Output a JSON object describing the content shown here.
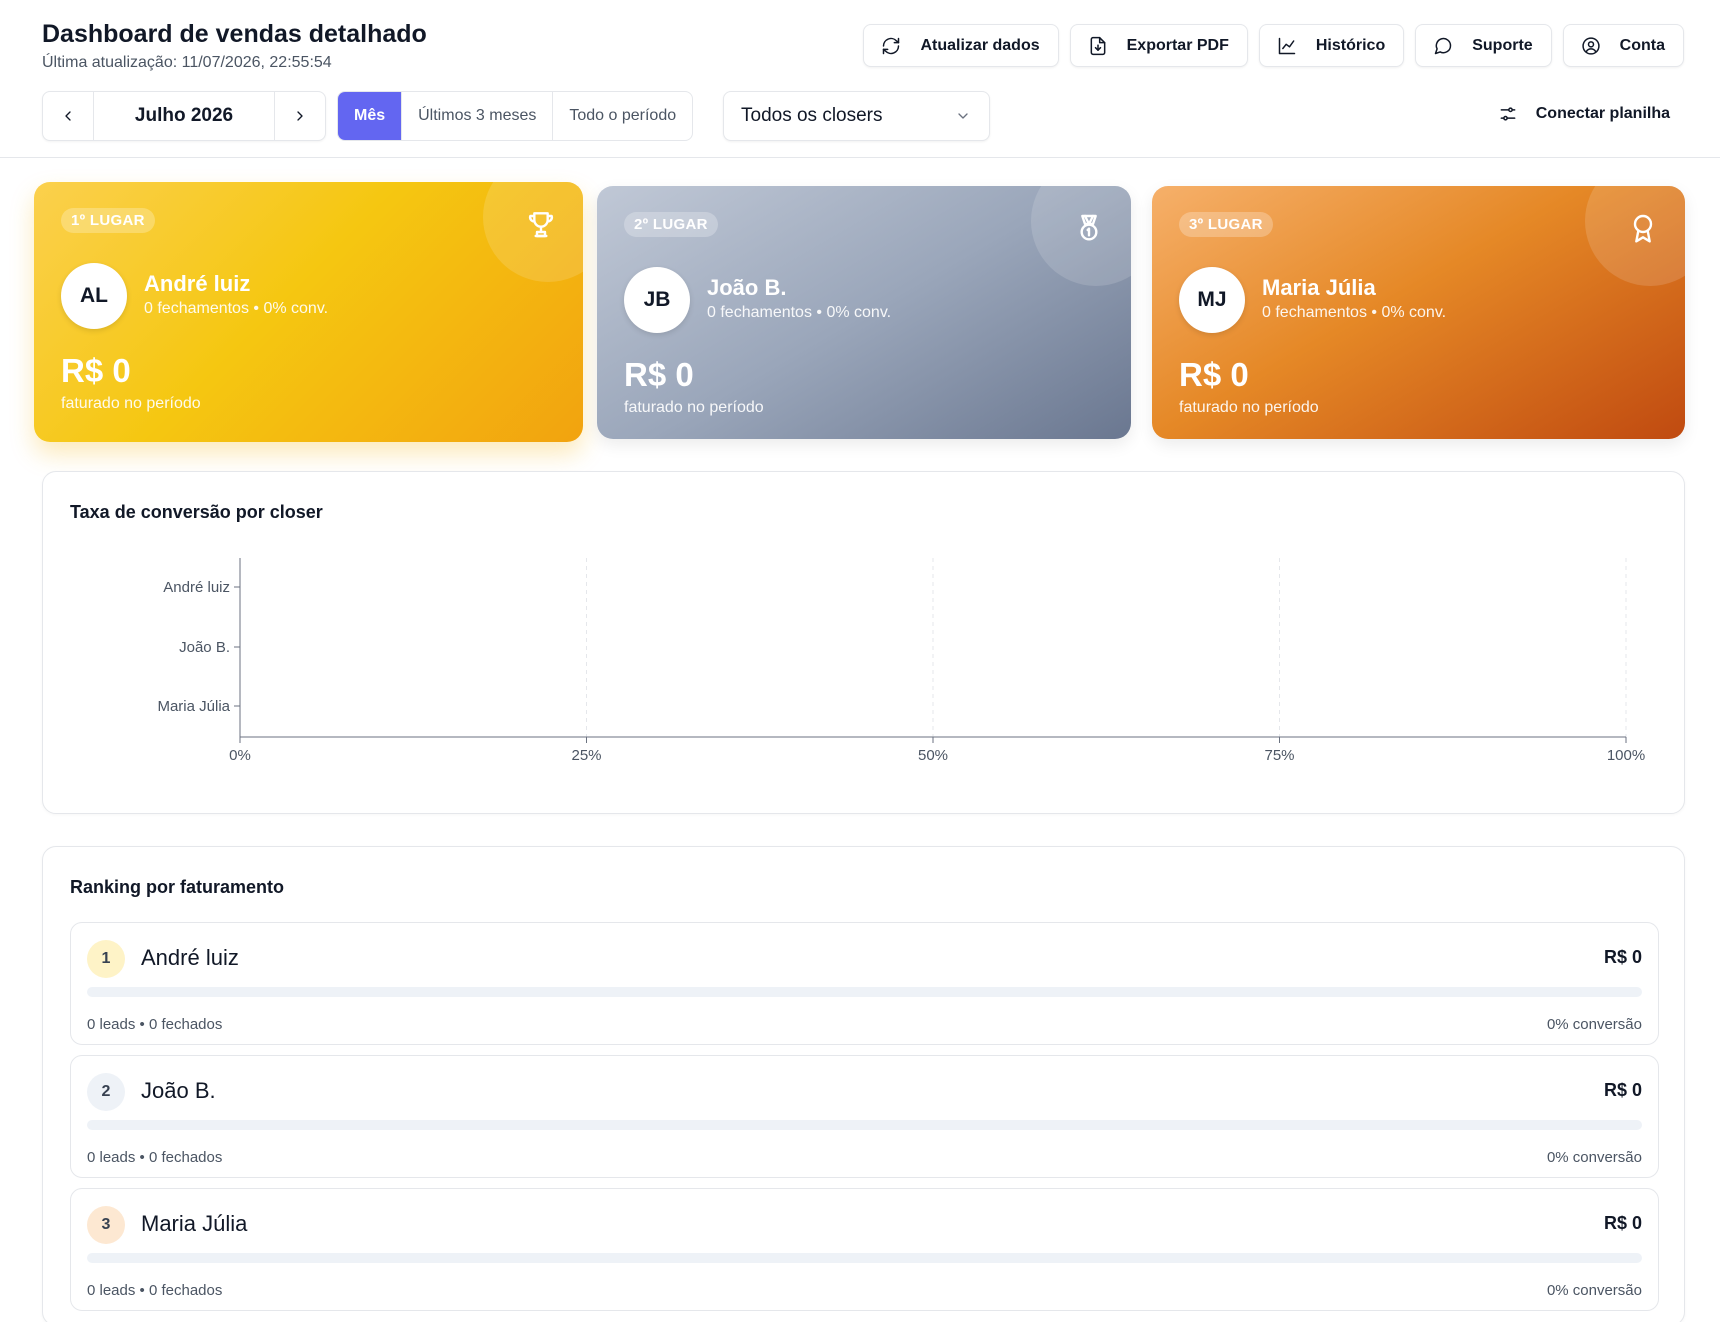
{
  "header": {
    "title": "Dashboard de vendas detalhado",
    "updated": "Última atualização: 11/07/2026, 22:55:54",
    "actions": [
      {
        "label": "Atualizar dados",
        "icon": "refresh-icon"
      },
      {
        "label": "Exportar PDF",
        "icon": "file-download-icon"
      },
      {
        "label": "Histórico",
        "icon": "line-chart-icon"
      },
      {
        "label": "Suporte",
        "icon": "message-circle-icon"
      },
      {
        "label": "Conta",
        "icon": "user-circle-icon"
      }
    ]
  },
  "filters": {
    "month": "Julho 2026",
    "period_tabs": [
      "Mês",
      "Últimos 3 meses",
      "Todo o período"
    ],
    "active_period": "Mês",
    "closer_select": "Todos os closers",
    "connect_label": "Conectar planilha"
  },
  "podium": [
    {
      "place": "1º LUGAR",
      "initials": "AL",
      "name": "André luiz",
      "meta": "0 fechamentos • 0% conv.",
      "amount": "R$ 0",
      "sub": "faturado no período",
      "icon": "trophy-icon"
    },
    {
      "place": "2º LUGAR",
      "initials": "JB",
      "name": "João B.",
      "meta": "0 fechamentos • 0% conv.",
      "amount": "R$ 0",
      "sub": "faturado no período",
      "icon": "medal-icon"
    },
    {
      "place": "3º LUGAR",
      "initials": "MJ",
      "name": "Maria Júlia",
      "meta": "0 fechamentos • 0% conv.",
      "amount": "R$ 0",
      "sub": "faturado no período",
      "icon": "award-icon"
    }
  ],
  "chart_panel": {
    "title": "Taxa de conversão por closer"
  },
  "chart_data": {
    "type": "bar",
    "orientation": "horizontal",
    "categories": [
      "André luiz",
      "João B.",
      "Maria Júlia"
    ],
    "values": [
      0,
      0,
      0
    ],
    "xlim": [
      0,
      100
    ],
    "x_ticks": [
      "0%",
      "25%",
      "50%",
      "75%",
      "100%"
    ],
    "grid": true
  },
  "ranking": {
    "title": "Ranking por faturamento",
    "rows": [
      {
        "rank": "1",
        "name": "André luiz",
        "amount": "R$ 0",
        "stats": "0 leads • 0 fechados",
        "conversion": "0% conversão",
        "progress": 0,
        "badge_color": "#fef3c7"
      },
      {
        "rank": "2",
        "name": "João B.",
        "amount": "R$ 0",
        "stats": "0 leads • 0 fechados",
        "conversion": "0% conversão",
        "progress": 0,
        "badge_color": "#eef2f7"
      },
      {
        "rank": "3",
        "name": "Maria Júlia",
        "amount": "R$ 0",
        "stats": "0 leads • 0 fechados",
        "conversion": "0% conversão",
        "progress": 0,
        "badge_color": "#fde8d2"
      }
    ]
  },
  "colors": {
    "accent": "#6366f1",
    "gold": "#f5c711",
    "silver": "#9aa6ba",
    "bronze": "#e58826"
  }
}
